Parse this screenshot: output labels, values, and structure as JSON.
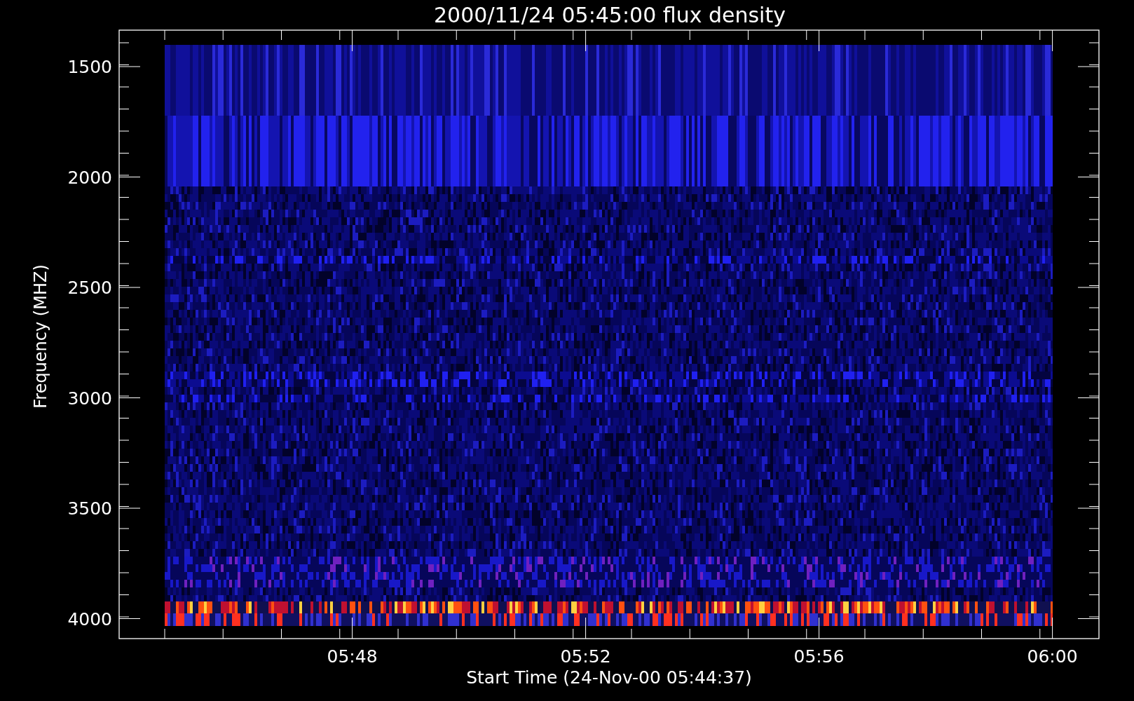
{
  "plot": {
    "title": "2000/11/24 05:45:00 flux density",
    "ylabel": "Frequency (MHZ)",
    "xlabel": "Start Time (24-Nov-00 05:44:37)",
    "y_tick_labels": [
      "1500",
      "2000",
      "2500",
      "3000",
      "3500",
      "4000"
    ],
    "x_tick_labels": [
      "05:48",
      "05:52",
      "05:56",
      "06:00"
    ]
  }
}
